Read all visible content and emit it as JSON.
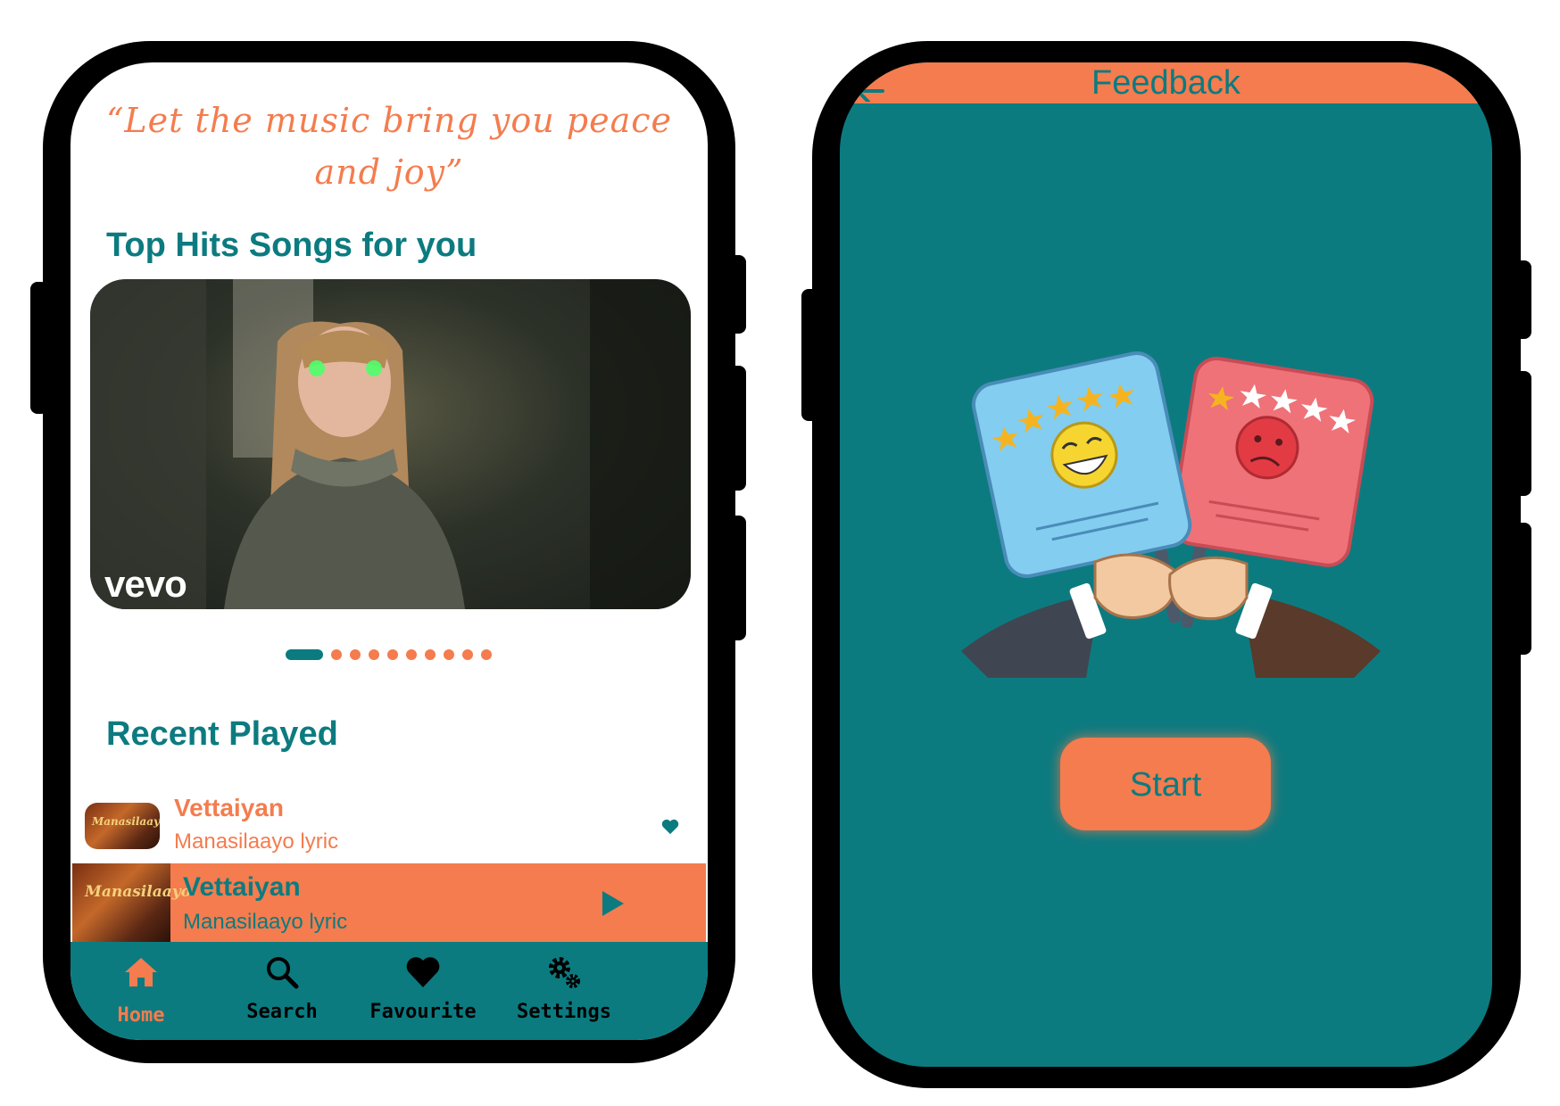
{
  "home": {
    "quote": "“Let the music bring you peace and joy”",
    "top_hits_title": "Top Hits Songs for you",
    "carousel": {
      "watermark": "vevo",
      "active_index": 0,
      "total": 10
    },
    "recent_title": "Recent Played",
    "recent_items": [
      {
        "title": "Vettaiyan",
        "subtitle": "Manasilaayo lyric",
        "favorite": true
      }
    ],
    "now_playing": {
      "title": "Vettaiyan",
      "subtitle": "Manasilaayo lyric",
      "state": "paused"
    },
    "thumbnail_text": "Manasilaayo",
    "nav": [
      {
        "label": "Home",
        "icon": "home-icon",
        "active": true
      },
      {
        "label": "Search",
        "icon": "search-icon",
        "active": false
      },
      {
        "label": "Favourite",
        "icon": "heart-icon",
        "active": false
      },
      {
        "label": "Settings",
        "icon": "gear-icon",
        "active": false
      }
    ]
  },
  "feedback": {
    "title": "Feedback",
    "start_label": "Start",
    "illustration": {
      "good_rating": 5,
      "bad_rating": 1,
      "max": 5
    }
  },
  "colors": {
    "accent": "#f47c4e",
    "primary": "#0c7b80",
    "frame": "#000000"
  }
}
